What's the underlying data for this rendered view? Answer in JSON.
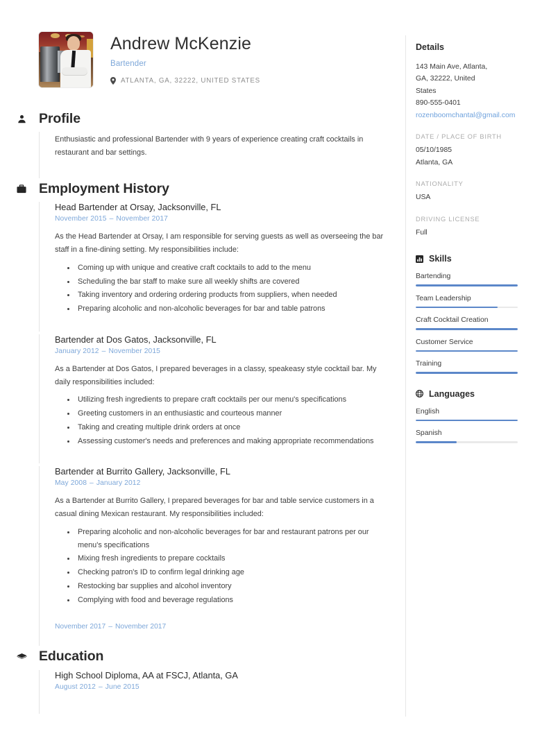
{
  "header": {
    "name": "Andrew McKenzie",
    "job_title": "Bartender",
    "location": "ATLANTA, GA, 32222, UNITED STATES",
    "photo_alt": "bartender-photo"
  },
  "sections": {
    "profile": {
      "title": "Profile",
      "icon": "person-icon",
      "text": "Enthusiastic and professional Bartender with 9 years of experience creating craft cocktails in restaurant and bar settings."
    },
    "employment": {
      "title": "Employment History",
      "icon": "briefcase-icon",
      "entries": [
        {
          "title": "Head Bartender at Orsay, Jacksonville, FL",
          "date_start": "November 2015",
          "date_end": "November 2017",
          "intro": "As the Head Bartender at Orsay, I am responsible for serving guests as well as overseeing the bar staff in a fine-dining setting. My responsibilities include:",
          "bullets": [
            "Coming up with unique and creative craft cocktails to add to the menu",
            "Scheduling the bar staff to make sure all weekly shifts are covered",
            "Taking inventory and ordering ordering products from suppliers, when needed",
            "Preparing alcoholic and non-alcoholic beverages for bar and table patrons"
          ]
        },
        {
          "title": "Bartender at Dos Gatos, Jacksonville, FL",
          "date_start": "January 2012",
          "date_end": "November 2015",
          "intro": "As a Bartender at Dos Gatos, I prepared beverages in a classy, speakeasy style cocktail bar. My daily responsibilities included:",
          "bullets": [
            "Utilizing fresh ingredients to prepare craft cocktails per our menu's specifications",
            "Greeting customers in an enthusiastic and courteous manner",
            "Taking and creating multiple drink orders at once",
            "Assessing customer's needs and preferences and making appropriate recommendations"
          ]
        },
        {
          "title": "Bartender at Burrito Gallery, Jacksonville, FL",
          "date_start": "May 2008",
          "date_end": "January 2012",
          "intro": "As a Bartender at Burrito Gallery, I prepared beverages for bar and table service customers in a casual dining Mexican restaurant. My responsibilities included:",
          "bullets": [
            "Preparing alcoholic and non-alcoholic beverages for bar and restaurant patrons per our menu's specifications",
            "Mixing fresh ingredients to prepare cocktails",
            "Checking patron's ID to confirm legal drinking age",
            "Restocking bar supplies and alcohol inventory",
            "Complying with food and beverage regulations"
          ]
        }
      ],
      "orphan_entry": {
        "date_start": "November 2017",
        "date_end": "November 2017"
      }
    },
    "education": {
      "title": "Education",
      "icon": "graduation-cap-icon",
      "entries": [
        {
          "title": "High School Diploma, AA at FSCJ, Atlanta, GA",
          "date_start": "August 2012",
          "date_end": "June 2015"
        }
      ]
    }
  },
  "sidebar": {
    "details": {
      "title": "Details",
      "address_lines": [
        "143 Main Ave, Atlanta,",
        "GA, 32222, United",
        "States"
      ],
      "phone": "890-555-0401",
      "email": "rozenboomchantal@gmail.com",
      "groups": [
        {
          "label": "DATE / PLACE OF BIRTH",
          "values": [
            "05/10/1985",
            "Atlanta, GA"
          ]
        },
        {
          "label": "NATIONALITY",
          "values": [
            "USA"
          ]
        },
        {
          "label": "DRIVING LICENSE",
          "values": [
            "Full"
          ]
        }
      ]
    },
    "skills": {
      "title": "Skills",
      "icon": "bar-chart-icon",
      "items": [
        {
          "name": "Bartending",
          "level": 100
        },
        {
          "name": "Team Leadership",
          "level": 80
        },
        {
          "name": "Craft Cocktail Creation",
          "level": 100
        },
        {
          "name": "Customer Service",
          "level": 100
        },
        {
          "name": "Training",
          "level": 100
        }
      ]
    },
    "languages": {
      "title": "Languages",
      "icon": "globe-icon",
      "items": [
        {
          "name": "English",
          "level": 100
        },
        {
          "name": "Spanish",
          "level": 40
        }
      ]
    }
  },
  "colors": {
    "accent_blue": "#7da7d9",
    "meter_fill": "#5b87c9",
    "meter_track": "#e9e9e9",
    "text_dark": "#2b2b2b",
    "text_muted": "#acacac"
  }
}
